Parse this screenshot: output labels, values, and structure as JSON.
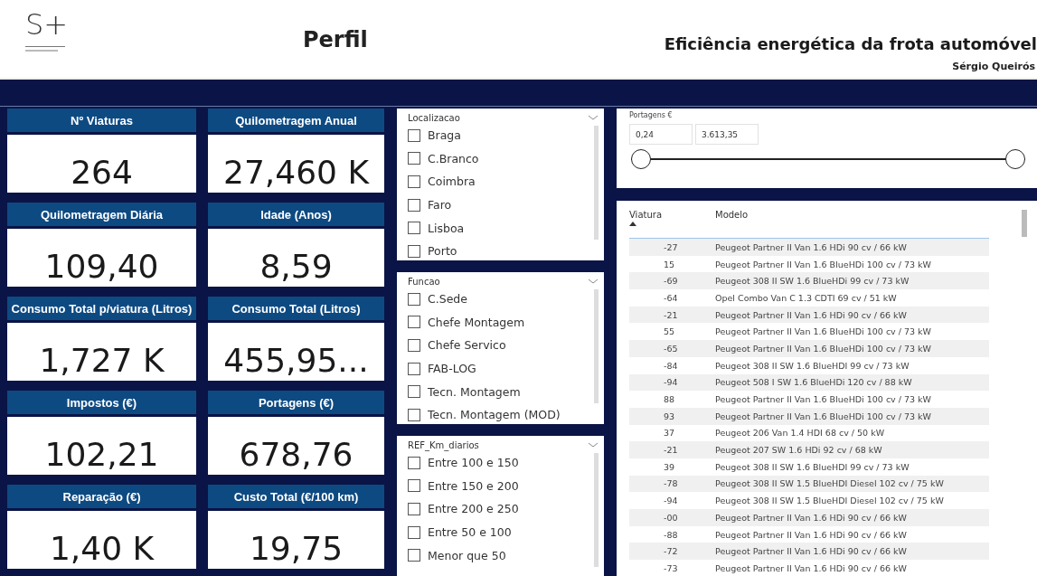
{
  "header": {
    "logo": "S+",
    "page_title": "Perfil",
    "report_title": "Eficiência energética da frota automóvel",
    "author": "Sérgio Queirós"
  },
  "kpis": [
    {
      "label": "Nº Viaturas",
      "value": "264"
    },
    {
      "label": "Quilometragem Anual",
      "value": "27,460 K"
    },
    {
      "label": "Quilometragem Diária",
      "value": "109,40"
    },
    {
      "label": "Idade (Anos)",
      "value": "8,59"
    },
    {
      "label": "Consumo Total p/viatura (Litros)",
      "value": "1,727 K"
    },
    {
      "label": "Consumo Total (Litros)",
      "value": "455,95..."
    },
    {
      "label": "Impostos (€)",
      "value": "102,21"
    },
    {
      "label": "Portagens (€)",
      "value": "678,76"
    },
    {
      "label": "Reparação (€)",
      "value": "1,40 K"
    },
    {
      "label": "Custo Total (€/100 km)",
      "value": "19,75"
    }
  ],
  "slicers": [
    {
      "title": "Localizacao",
      "items": [
        {
          "label": "Braga",
          "checked": false
        },
        {
          "label": "C.Branco",
          "checked": false
        },
        {
          "label": "Coimbra",
          "checked": false
        },
        {
          "label": "Faro",
          "checked": false
        },
        {
          "label": "Lisboa",
          "checked": false
        },
        {
          "label": "Porto",
          "checked": false
        }
      ]
    },
    {
      "title": "Funcao",
      "items": [
        {
          "label": "C.Sede",
          "checked": false
        },
        {
          "label": "Chefe Montagem",
          "checked": false
        },
        {
          "label": "Chefe Servico",
          "checked": false
        },
        {
          "label": "FAB-LOG",
          "checked": false
        },
        {
          "label": "Tecn. Montagem",
          "checked": false
        },
        {
          "label": "Tecn. Montagem (MOD)",
          "checked": false
        }
      ]
    },
    {
      "title": "REF_Km_diarios",
      "items": [
        {
          "label": "Entre 100 e 150",
          "checked": false
        },
        {
          "label": "Entre 150 e 200",
          "checked": false
        },
        {
          "label": "Entre 200 e 250",
          "checked": false
        },
        {
          "label": "Entre 50 e 100",
          "checked": false
        },
        {
          "label": "Menor que 50",
          "checked": false
        }
      ]
    }
  ],
  "range_slider": {
    "title": "Portagens €",
    "min": "0,24",
    "max": "3.613,35",
    "level": 1
  },
  "table": {
    "columns": [
      "Viatura",
      "Modelo"
    ],
    "rows": [
      [
        "-27",
        "Peugeot Partner II Van 1.6 HDi 90 cv / 66 kW"
      ],
      [
        "15",
        "Peugeot Partner II Van 1.6 BlueHDi 100 cv / 73 kW"
      ],
      [
        "-69",
        "Peugeot 308 II SW 1.6 BlueHDi 99 cv / 73 kW"
      ],
      [
        "-64",
        "Opel Combo Van C 1.3 CDTI 69 cv / 51 kW"
      ],
      [
        "-21",
        "Peugeot Partner II Van 1.6 HDi 90 cv / 66 kW"
      ],
      [
        "55",
        "Peugeot Partner II Van 1.6 BlueHDi 100 cv / 73 kW"
      ],
      [
        "-65",
        "Peugeot Partner II Van 1.6 BlueHDi 100 cv / 73 kW"
      ],
      [
        "-84",
        "Peugeot 308 II SW 1.6 BlueHDI 99 cv / 73 kW"
      ],
      [
        "-94",
        "Peugeot 508 I SW 1.6 BlueHDi 120 cv / 88 kW"
      ],
      [
        "88",
        "Peugeot Partner II Van 1.6 BlueHDi 100 cv / 73 kW"
      ],
      [
        "93",
        "Peugeot Partner II Van 1.6 BlueHDi 100 cv / 73 kW"
      ],
      [
        "37",
        "Peugeot 206 Van 1.4 HDI 68 cv / 50 kW"
      ],
      [
        "-21",
        "Peugeot 207 SW 1.6 HDi 92 cv / 68 kW"
      ],
      [
        "39",
        "Peugeot 308 II SW 1.6 BlueHDI 99 cv / 73 kW"
      ],
      [
        "-78",
        "Peugeot 308 II SW 1.5 BlueHDI Diesel 102 cv / 75 kW"
      ],
      [
        "-94",
        "Peugeot 308 II SW 1.5 BlueHDI Diesel 102 cv / 75 kW"
      ],
      [
        "-00",
        "Peugeot Partner II Van 1.6 HDi 90 cv / 66 kW"
      ],
      [
        "-88",
        "Peugeot Partner II Van 1.6 HDi 90 cv / 66 kW"
      ],
      [
        "-72",
        "Peugeot Partner II Van 1.6 HDi 90 cv / 66 kW"
      ],
      [
        "-73",
        "Peugeot Partner II Van 1.6 HDi 90 cv / 66 kW"
      ]
    ]
  }
}
